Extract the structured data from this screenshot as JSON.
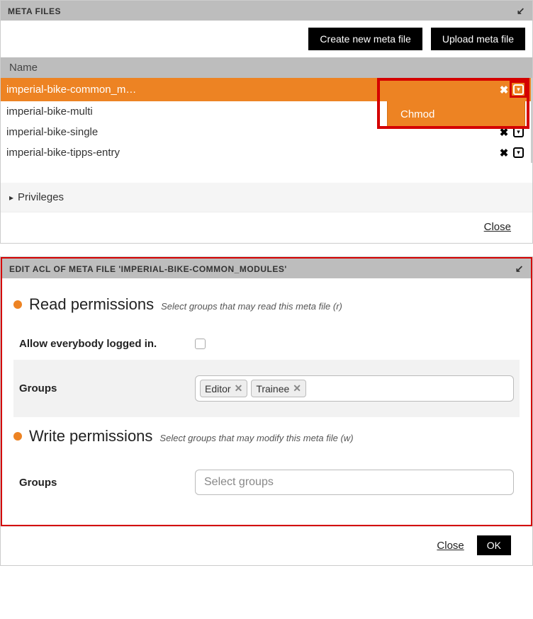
{
  "panels": {
    "meta_files": {
      "title": "META FILES",
      "buttons": {
        "create": "Create new meta file",
        "upload": "Upload meta file"
      },
      "col_name": "Name",
      "files": [
        {
          "name": "imperial-bike-common_m…",
          "selected": true,
          "has_actions": true
        },
        {
          "name": "imperial-bike-multi",
          "selected": false,
          "has_actions": false
        },
        {
          "name": "imperial-bike-single",
          "selected": false,
          "has_actions": true
        },
        {
          "name": "imperial-bike-tipps-entry",
          "selected": false,
          "has_actions": true
        }
      ],
      "dropdown_item": "Chmod",
      "privileges": "Privileges",
      "close": "Close"
    },
    "acl": {
      "title": "EDIT ACL OF META FILE 'IMPERIAL-BIKE-COMMON_MODULES'",
      "read": {
        "heading": "Read permissions",
        "hint": "Select groups that may read this meta file (r)",
        "allow_label": "Allow everybody logged in.",
        "groups_label": "Groups",
        "tags": [
          "Editor",
          "Trainee"
        ]
      },
      "write": {
        "heading": "Write permissions",
        "hint": "Select groups that may modify this meta file (w)",
        "groups_label": "Groups",
        "placeholder": "Select groups"
      },
      "close": "Close",
      "ok": "OK"
    }
  }
}
